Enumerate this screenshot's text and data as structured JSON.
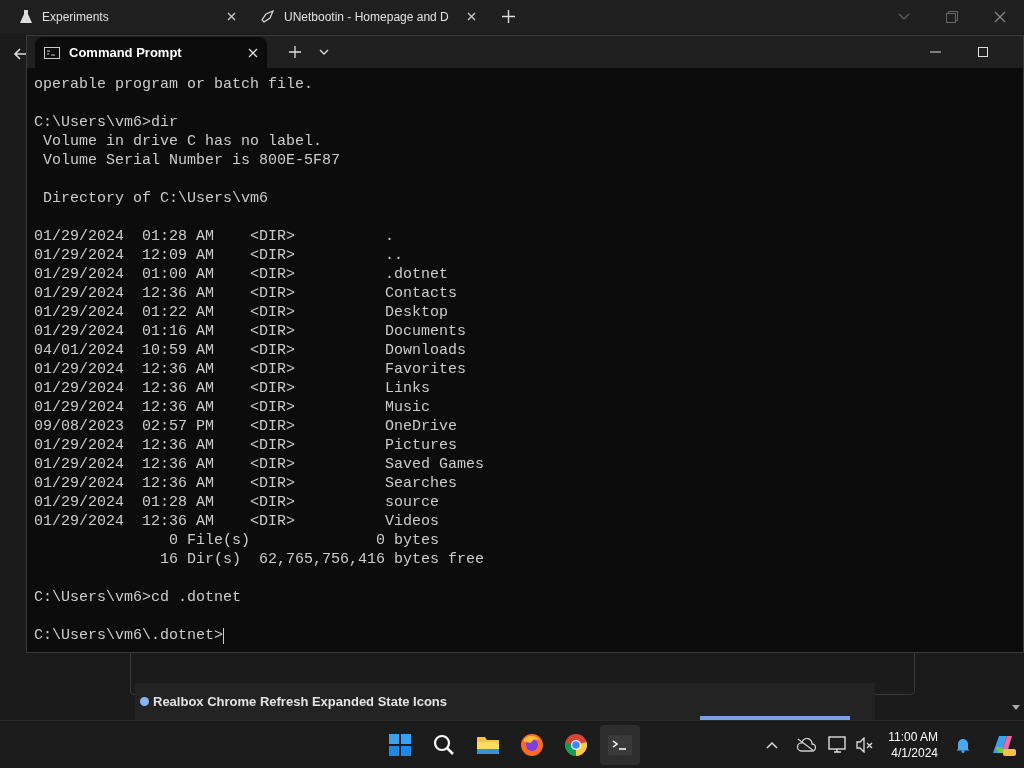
{
  "browser": {
    "tabs": [
      {
        "title": "Experiments"
      },
      {
        "title": "UNetbootin - Homepage and D"
      }
    ]
  },
  "terminal": {
    "tab_title": "Command Prompt",
    "blocks": [
      [
        "operable program or batch file."
      ],
      [
        "C:\\Users\\vm6>dir",
        " Volume in drive C has no label.",
        " Volume Serial Number is 800E-5F87"
      ],
      [
        " Directory of C:\\Users\\vm6"
      ],
      [
        "01/29/2024  01:28 AM    <DIR>          .",
        "01/29/2024  12:09 AM    <DIR>          ..",
        "01/29/2024  01:00 AM    <DIR>          .dotnet",
        "01/29/2024  12:36 AM    <DIR>          Contacts",
        "01/29/2024  01:22 AM    <DIR>          Desktop",
        "01/29/2024  01:16 AM    <DIR>          Documents",
        "04/01/2024  10:59 AM    <DIR>          Downloads",
        "01/29/2024  12:36 AM    <DIR>          Favorites",
        "01/29/2024  12:36 AM    <DIR>          Links",
        "01/29/2024  12:36 AM    <DIR>          Music",
        "09/08/2023  02:57 PM    <DIR>          OneDrive",
        "01/29/2024  12:36 AM    <DIR>          Pictures",
        "01/29/2024  12:36 AM    <DIR>          Saved Games",
        "01/29/2024  12:36 AM    <DIR>          Searches",
        "01/29/2024  01:28 AM    <DIR>          source",
        "01/29/2024  12:36 AM    <DIR>          Videos",
        "               0 File(s)              0 bytes",
        "              16 Dir(s)  62,765,756,416 bytes free"
      ],
      [
        "C:\\Users\\vm6>cd .dotnet"
      ],
      [
        "C:\\Users\\vm6\\.dotnet>"
      ]
    ]
  },
  "page": {
    "item_title": "Realbox Chrome Refresh Expanded State Icons"
  },
  "taskbar": {
    "time": "11:00 AM",
    "date": "4/1/2024"
  }
}
